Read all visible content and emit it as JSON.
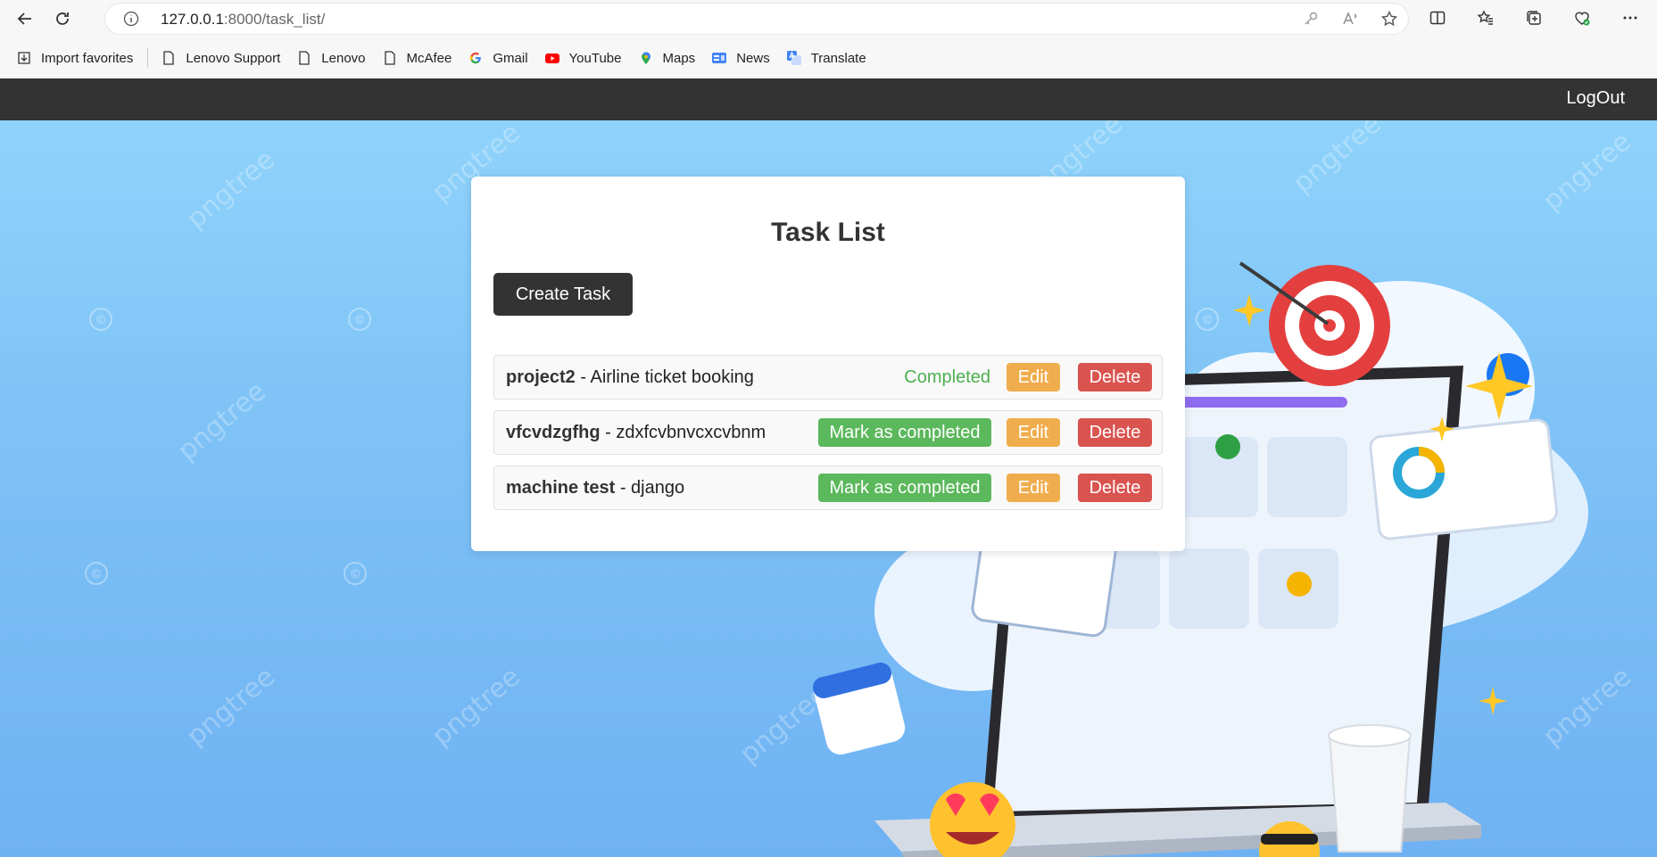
{
  "browser": {
    "url_host": "127.0.0.1",
    "url_rest": ":8000/task_list/",
    "bookmarks": [
      {
        "label": "Import favorites",
        "icon": "import-icon"
      },
      {
        "label": "Lenovo Support",
        "icon": "page-icon"
      },
      {
        "label": "Lenovo",
        "icon": "page-icon"
      },
      {
        "label": "McAfee",
        "icon": "page-icon"
      },
      {
        "label": "Gmail",
        "icon": "google-icon"
      },
      {
        "label": "YouTube",
        "icon": "youtube-icon"
      },
      {
        "label": "Maps",
        "icon": "maps-pin-icon"
      },
      {
        "label": "News",
        "icon": "news-icon"
      },
      {
        "label": "Translate",
        "icon": "translate-icon"
      }
    ]
  },
  "navbar": {
    "logout_label": "LogOut"
  },
  "watermark": {
    "text": "pngtree"
  },
  "card": {
    "title": "Task List",
    "create_label": "Create Task",
    "tasks": [
      {
        "name": "project2",
        "separator": " - ",
        "description": "Airline ticket booking",
        "status_text": "Completed",
        "edit_label": "Edit",
        "delete_label": "Delete"
      },
      {
        "name": "vfcvdzgfhg",
        "separator": " - ",
        "description": "zdxfcvbnvcxcvbnm",
        "action_label": "Mark as completed",
        "edit_label": "Edit",
        "delete_label": "Delete"
      },
      {
        "name": "machine test",
        "separator": " - ",
        "description": "django",
        "action_label": "Mark as completed",
        "edit_label": "Edit",
        "delete_label": "Delete"
      }
    ]
  },
  "colors": {
    "navbar": "#333333",
    "completed": "#4caf50",
    "mark_button": "#5cb85c",
    "edit_button": "#f0ad4e",
    "delete_button": "#d9534f",
    "background_top": "#8fd3fb",
    "background_bottom": "#6fb2f3"
  }
}
